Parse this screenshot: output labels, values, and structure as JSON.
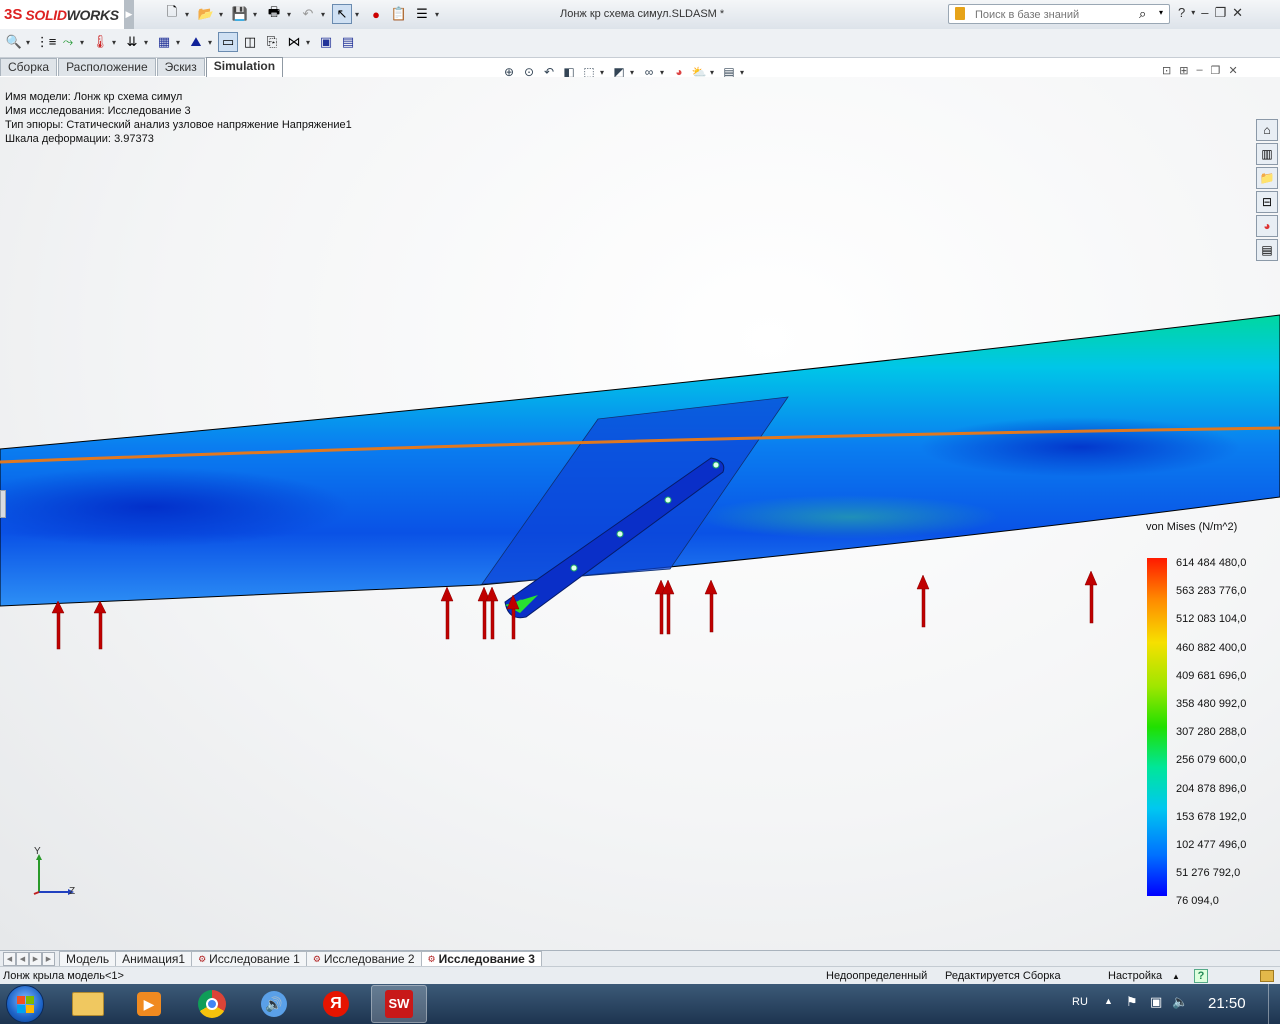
{
  "app": {
    "logo": {
      "mark": "3S",
      "solid": "SOLID",
      "works": "WORKS"
    },
    "doc_title": "Лонж кр схема симул.SLDASM *",
    "search": {
      "placeholder": "Поиск в базе знаний"
    },
    "help": "?"
  },
  "cm_tabs": [
    {
      "label": "Сборка"
    },
    {
      "label": "Расположение"
    },
    {
      "label": "Эскиз"
    },
    {
      "label": "Simulation",
      "active": true
    }
  ],
  "info": {
    "model_label": "Имя модели:",
    "model_name": "Лонж кр схема симул",
    "study_label": "Имя  исследования:",
    "study_name": "Исследование 3",
    "plot_label": "Тип эпюры:",
    "plot_type": "Статический анализ узловое напряжение Напряжение1",
    "scale_label": "Шкала деформации:",
    "scale_value": "3.97373"
  },
  "legend": {
    "title": "von Mises (N/m^2)",
    "values": [
      "614 484 480,0",
      "563 283 776,0",
      "512 083 104,0",
      "460 882 400,0",
      "409 681 696,0",
      "358 480 992,0",
      "307 280 288,0",
      "256 079 600,0",
      "204 878 896,0",
      "153 678 192,0",
      "102 477 496,0",
      "51 276 792,0",
      "76 094,0"
    ],
    "colors": [
      "#ff1a00",
      "#ff8800",
      "#f6e000",
      "#20e000",
      "#00c8f0",
      "#0000ff"
    ]
  },
  "triad": {
    "y": "Y",
    "z": "Z"
  },
  "bottom_tabs": [
    {
      "label": "Модель",
      "sim": false
    },
    {
      "label": "Анимация1",
      "sim": false
    },
    {
      "label": "Исследование 1",
      "sim": true
    },
    {
      "label": "Исследование 2",
      "sim": true
    },
    {
      "label": "Исследование 3",
      "sim": true,
      "active": true
    }
  ],
  "status": {
    "component": "Лонж крыла модель<1>",
    "definition": "Недоопределенный",
    "mode": "Редактируется Сборка",
    "settings": "Настройка"
  },
  "taskbar": {
    "lang": "RU",
    "time": "21:50",
    "apps": [
      "file-explorer",
      "media-player",
      "chrome",
      "volume-app",
      "yandex-browser",
      "solidworks"
    ]
  }
}
